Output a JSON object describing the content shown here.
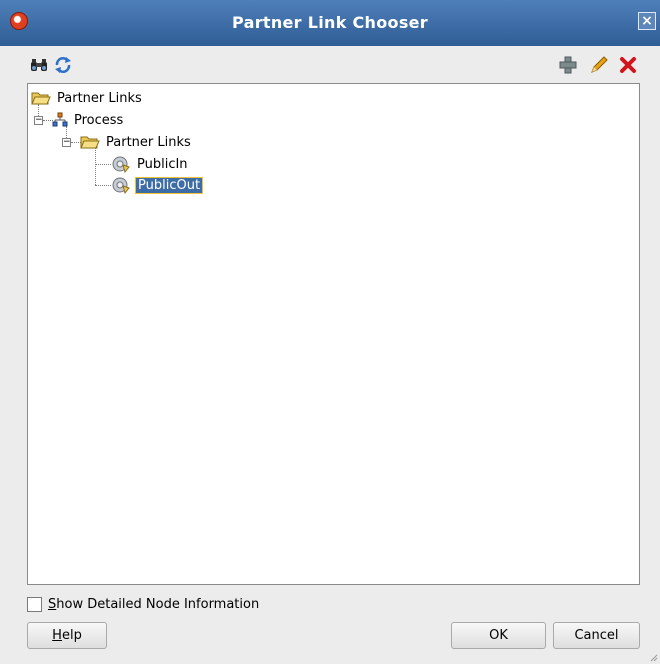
{
  "window": {
    "title": "Partner Link Chooser"
  },
  "tree": {
    "root": "Partner Links",
    "process": "Process",
    "partner_links": "Partner Links",
    "children": [
      "PublicIn",
      "PublicOut"
    ]
  },
  "options": {
    "show_detailed_underlined": "S",
    "show_detailed_rest": "how Detailed Node Information"
  },
  "buttons": {
    "help_underlined": "H",
    "help_rest": "elp",
    "ok": "OK",
    "cancel": "Cancel"
  },
  "icons": {
    "find": "binoculars-icon",
    "refresh": "refresh-icon",
    "add": "plus-icon",
    "edit": "pencil-icon",
    "delete": "x-icon"
  },
  "colors": {
    "title_bar": "#3a6aa6",
    "selection": "#3e6da6",
    "selection_border": "#f1c233"
  }
}
